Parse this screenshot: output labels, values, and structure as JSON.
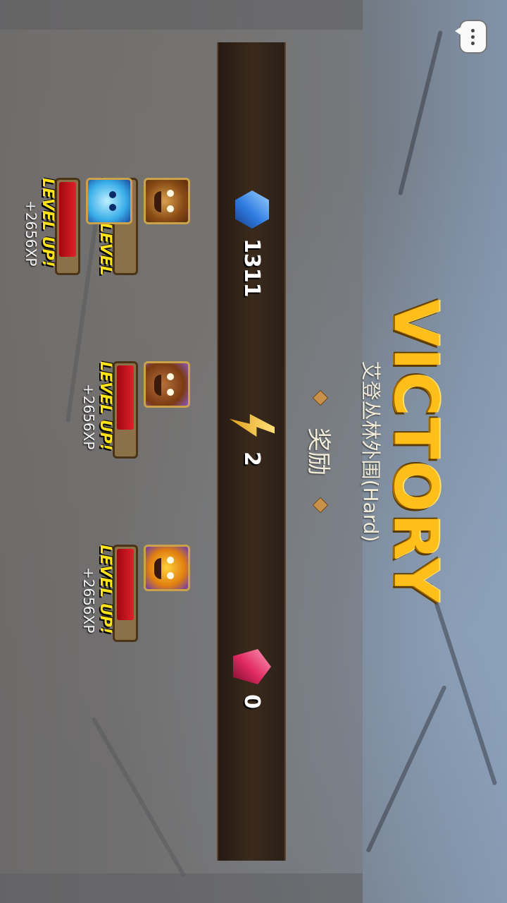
{
  "title": "VICTORY",
  "stage_name": "艾登丛林外围(Hard)",
  "reward_label": "奖励",
  "rewards": {
    "gems": {
      "value": "1311",
      "icon": "blue-gem-icon"
    },
    "energy": {
      "value": "2",
      "icon": "lightning-icon"
    },
    "ruby": {
      "value": "0",
      "icon": "red-gem-icon"
    }
  },
  "heroes": [
    {
      "id": "beast",
      "status": "MAX LEVEL",
      "xp": "",
      "progress": 0.0
    },
    {
      "id": "bunny",
      "status": "LEVEL UP!",
      "xp": "+2656XP",
      "progress": 0.72
    },
    {
      "id": "sun",
      "status": "LEVEL UP!",
      "xp": "+2656XP",
      "progress": 0.8
    },
    {
      "id": "ghost",
      "status": "LEVEL UP!",
      "xp": "+2656XP",
      "progress": 0.84
    }
  ],
  "colors": {
    "title": "#ffbf1a",
    "status": "#ffe21a",
    "xp_fill": "#d0141e"
  }
}
